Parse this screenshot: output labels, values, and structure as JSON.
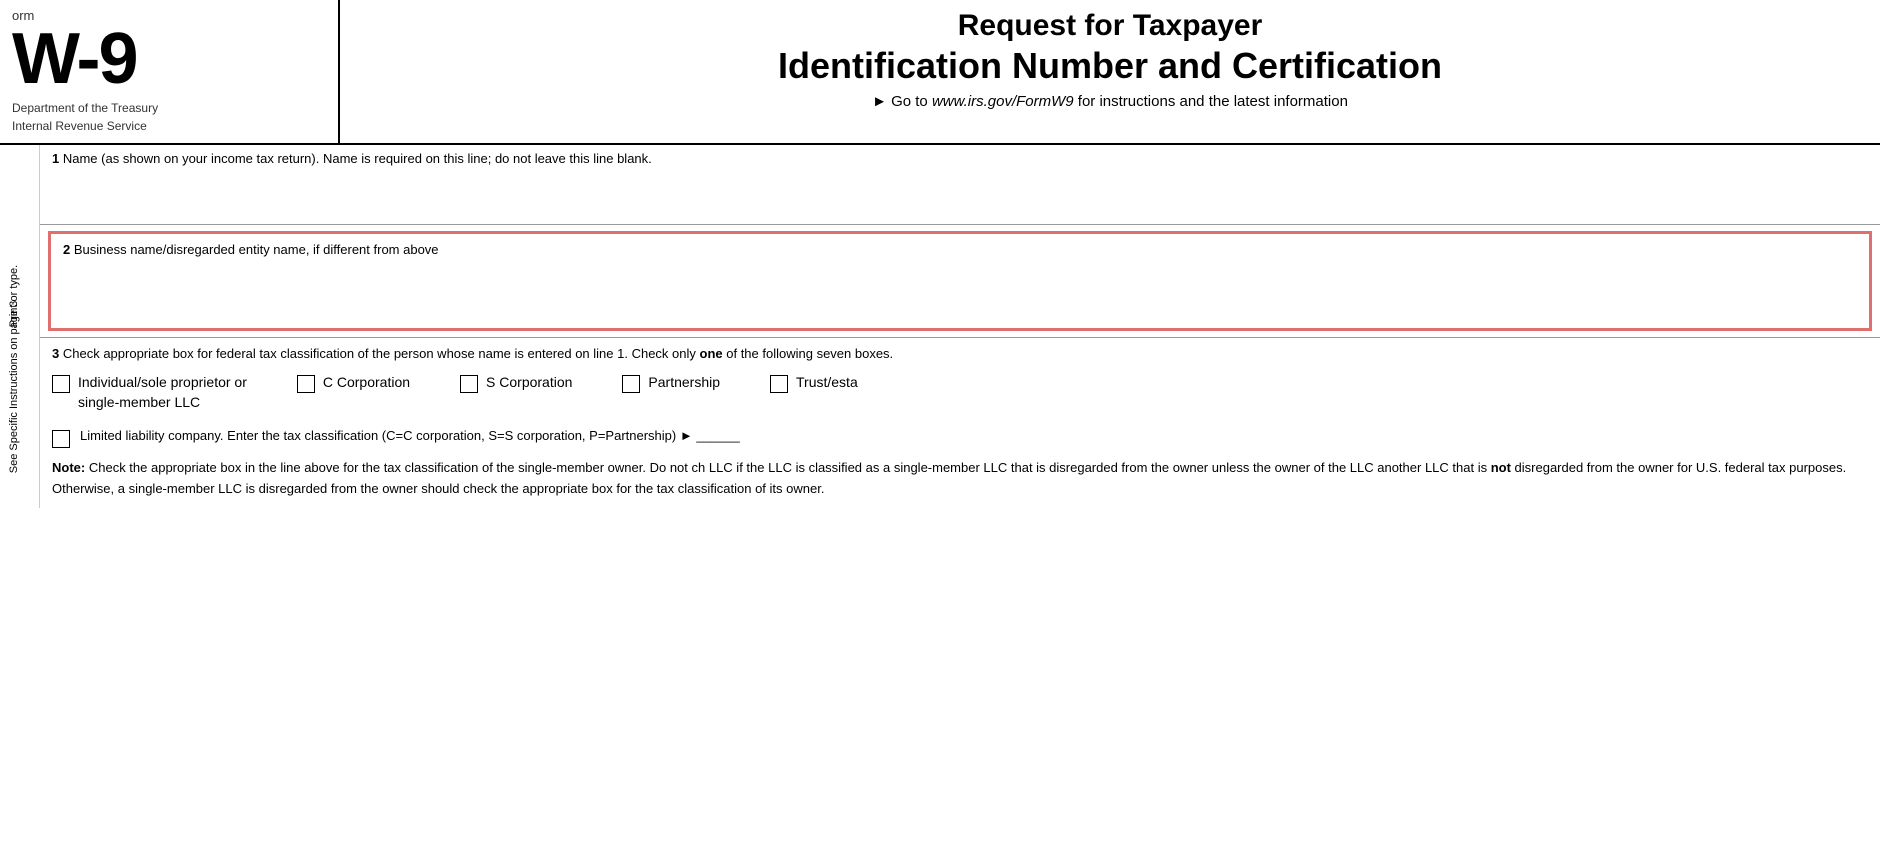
{
  "header": {
    "form_label": "orm",
    "form_number": "W-9",
    "dept_line1": "Department of the Treasury",
    "dept_line2": "Internal Revenue Service",
    "title_request": "Request for Taxpayer",
    "title_main": "Identification Number and Certification",
    "website_text": "► Go to ",
    "website_url": "www.irs.gov/FormW9",
    "website_suffix": " for instructions and the latest information"
  },
  "sidebar": {
    "text1": "Print or type.",
    "text2": "See Specific Instructions on page 3"
  },
  "fields": {
    "field1": {
      "number": "1",
      "label": "Name (as shown on your income tax return). Name is required on this line; do not leave this line blank."
    },
    "field2": {
      "number": "2",
      "label": "Business name/disregarded entity name, if different from above"
    },
    "field3": {
      "number": "3",
      "intro_text": "Check appropriate box for federal tax classification of the person whose name is entered on line 1. Check only",
      "intro_bold": "one",
      "intro_suffix": " of the following seven boxes.",
      "checkboxes": [
        {
          "id": "individual",
          "label": "Individual/sole proprietor or single-member LLC"
        },
        {
          "id": "c-corp",
          "label": "C Corporation"
        },
        {
          "id": "s-corp",
          "label": "S Corporation"
        },
        {
          "id": "partnership",
          "label": "Partnership"
        },
        {
          "id": "trust",
          "label": "Trust/esta"
        }
      ],
      "llc_label": "Limited liability company. Enter the tax classification (C=C corporation, S=S corporation, P=Partnership) ►",
      "llc_line": "______",
      "note_label": "Note:",
      "note_text": " Check the appropriate box in the line above for the tax classification of the single-member owner.  Do not ch LLC if the LLC is classified as a single-member LLC that is disregarded from the owner unless the owner of the LLC another LLC that is",
      "note_bold": "not",
      "note_text2": " disregarded from the owner for U.S. federal tax purposes. Otherwise, a single-member LLC is disregarded from the owner should check the appropriate box for the tax classification of its owner."
    }
  }
}
